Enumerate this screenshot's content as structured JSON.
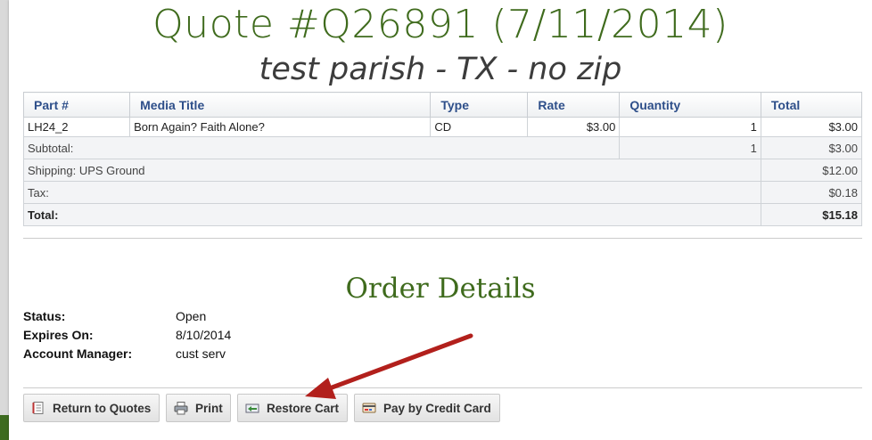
{
  "page": {
    "title": "Quote #Q26891 (7/11/2014)",
    "subtitle": "test parish - TX - no zip"
  },
  "table": {
    "headers": [
      "Part #",
      "Media Title",
      "Type",
      "Rate",
      "Quantity",
      "Total"
    ],
    "rows": [
      {
        "part": "LH24_2",
        "title": "Born Again? Faith Alone?",
        "type": "CD",
        "rate": "$3.00",
        "quantity": "1",
        "total": "$3.00"
      }
    ],
    "subtotal": {
      "label": "Subtotal:",
      "quantity": "1",
      "total": "$3.00"
    },
    "shipping": {
      "label": "Shipping: UPS Ground",
      "total": "$12.00"
    },
    "tax": {
      "label": "Tax:",
      "total": "$0.18"
    },
    "grand_total": {
      "label": "Total:",
      "total": "$15.18"
    }
  },
  "order_details": {
    "title": "Order Details",
    "status_label": "Status:",
    "status_value": "Open",
    "expires_label": "Expires On:",
    "expires_value": "8/10/2014",
    "manager_label": "Account Manager:",
    "manager_value": "cust serv"
  },
  "buttons": {
    "return": "Return to Quotes",
    "print": "Print",
    "restore": "Restore Cart",
    "pay": "Pay by Credit Card"
  },
  "colors": {
    "heading_green": "#3f6b1d",
    "header_blue": "#2e4f8a",
    "arrow_red": "#b2201c",
    "band_green": "#3d6b1f"
  }
}
